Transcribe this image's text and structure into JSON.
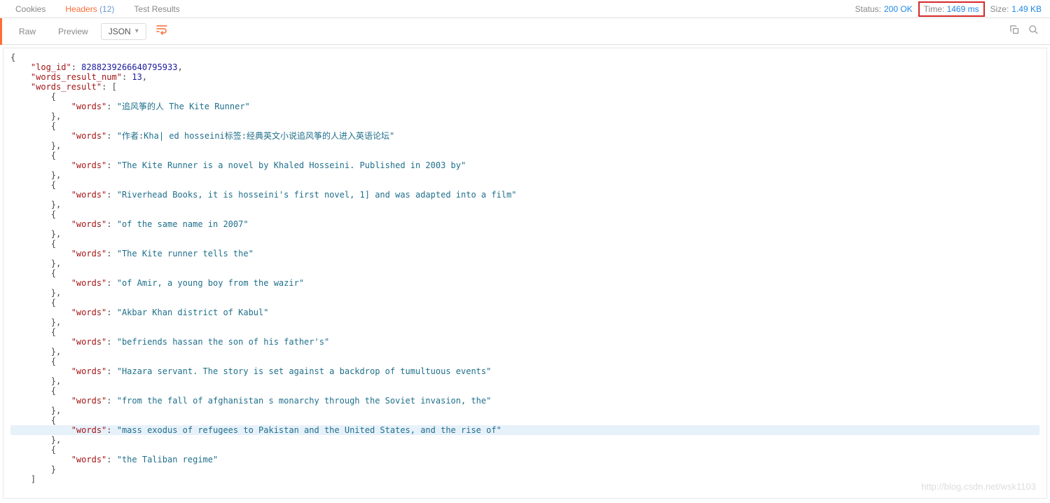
{
  "tabs": {
    "cookies": "Cookies",
    "headers_label": "Headers",
    "headers_count": "(12)",
    "tests": "Test Results"
  },
  "status": {
    "status_label": "Status:",
    "status_value": "200 OK",
    "time_label": "Time:",
    "time_value": "1469 ms",
    "size_label": "Size:",
    "size_value": "1.49 KB"
  },
  "toolbar": {
    "raw": "Raw",
    "preview": "Preview",
    "format": "JSON"
  },
  "response": {
    "log_id_key": "\"log_id\"",
    "log_id_val": "8288239266640795933",
    "num_key": "\"words_result_num\"",
    "num_val": "13",
    "result_key": "\"words_result\"",
    "words_key": "\"words\"",
    "items": [
      "\"追风筝的人 The Kite Runner\"",
      "\"作者:Kha| ed hosseini标签:经典英文小说追风筝的人进入英语论坛\"",
      "\"The Kite Runner is a novel by Khaled Hosseini. Published in 2003 by\"",
      "\"Riverhead Books, it is hosseini's first novel, 1] and was adapted into a film\"",
      "\"of the same name in 2007\"",
      "\"The Kite runner tells the\"",
      "\"of Amir, a young boy from the wazir\"",
      "\"Akbar Khan district of Kabul\"",
      "\"befriends hassan the son of his father's\"",
      "\"Hazara servant. The story is set against a backdrop of tumultuous events\"",
      "\"from the fall of afghanistan s monarchy through the Soviet invasion, the\"",
      "\"mass exodus of refugees to Pakistan and the United States, and the rise of\"",
      "\"the Taliban regime\""
    ],
    "highlight_index": 11
  },
  "watermark": "http://blog.csdn.net/wsk1103"
}
